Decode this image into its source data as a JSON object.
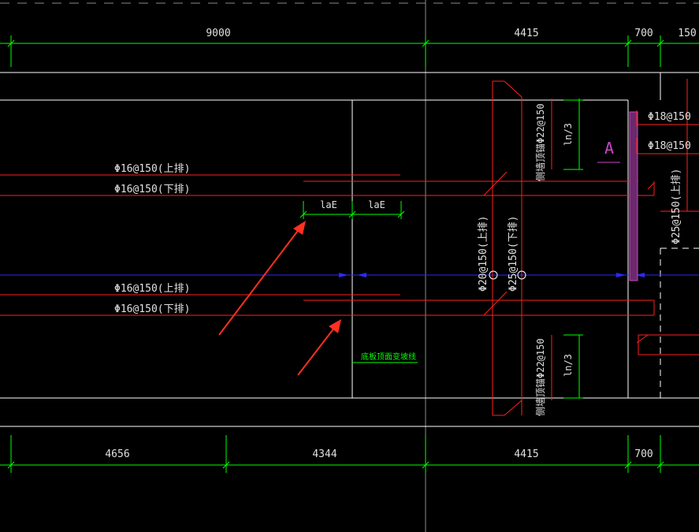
{
  "dimensions": {
    "top": [
      "9000",
      "4415",
      "700",
      "150"
    ],
    "bottom": [
      "4656",
      "4344",
      "4415",
      "700"
    ]
  },
  "rebar_labels": {
    "left_upper_top": "Φ16@150(上排)",
    "left_upper_bottom": "Φ16@150(下排)",
    "left_lower_top": "Φ16@150(上排)",
    "left_lower_bottom": "Φ16@150(下排)",
    "center_top": "Φ20@150(上排)",
    "center_bottom": "Φ25@150(下排)",
    "right_top_1": "Φ18@150",
    "right_top_2": "Φ18@150",
    "right_vertical": "Φ25@150(上排)",
    "lae_left": "laE",
    "lae_right": "laE",
    "ln3_top": "ln/3",
    "ln3_bottom": "ln/3",
    "side_anchor_top": "侧墙顶锚Φ22@150",
    "side_anchor_bottom": "侧墙顶锚Φ22@150",
    "section_mark": "A",
    "note_green": "底板顶面变坡线"
  },
  "colors": {
    "background": "#000000",
    "dimension": "#00ff00",
    "outline": "#ffffff",
    "rebar": "#ff2020",
    "axis": "#2020ff",
    "grid": "#7f7f7f",
    "section_mark": "#cc44cc",
    "arrow": "#ff3020"
  }
}
